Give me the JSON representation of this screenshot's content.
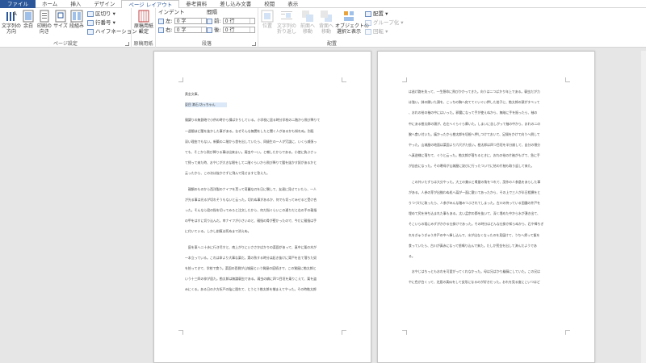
{
  "tabs": [
    {
      "label": "ファイル",
      "kind": "file"
    },
    {
      "label": "ホーム",
      "kind": ""
    },
    {
      "label": "挿入",
      "kind": ""
    },
    {
      "label": "デザイン",
      "kind": ""
    },
    {
      "label": "ページ レイアウト",
      "kind": "active"
    },
    {
      "label": "参考資料",
      "kind": ""
    },
    {
      "label": "差し込み文書",
      "kind": ""
    },
    {
      "label": "校閲",
      "kind": ""
    },
    {
      "label": "表示",
      "kind": ""
    }
  ],
  "ribbon": {
    "page_setup": {
      "label": "ページ設定",
      "text_direction": "文字列の\n方向",
      "margins": "余白",
      "orientation": "印刷の\n向き",
      "size": "サイズ",
      "columns": "段組み",
      "breaks": "区切り",
      "line_numbers": "行番号",
      "hyphenation": "ハイフネーション"
    },
    "manuscript": {
      "label": "原稿用紙",
      "button": "原稿用紙\n設定"
    },
    "paragraph": {
      "label": "段落",
      "indent_heading": "インデント",
      "spacing_heading": "間隔",
      "indent_left_label": "左:",
      "indent_right_label": "右:",
      "indent_left_value": "0 字",
      "indent_right_value": "0 字",
      "spacing_before_label": "前:",
      "spacing_after_label": "後:",
      "spacing_before_value": "0 行",
      "spacing_after_value": "0 行"
    },
    "arrange": {
      "label": "配置",
      "position": "位置",
      "wrap_text": "文字列の\n折り返し",
      "bring_forward": "前面へ\n移動",
      "send_backward": "背面へ\n移動",
      "selection_pane": "オブジェクトの\n選択と表示",
      "align": "配置",
      "group": "グループ化",
      "rotate": "回転"
    }
  },
  "page1": {
    "lines": [
      {
        "text": "黄金文庫。",
        "gap": 0
      },
      {
        "text": "夏目 漱石  坊っちゃん",
        "gap": 0,
        "name": true
      },
      {
        "text": "親譲りの無鉄砲で小供の時から損ばかりしている。小学校に居る時分学校の二階から飛び降りて",
        "gap": 1
      },
      {
        "text": "一週間ほど腰を抜かした事がある。なぜそんな無闇をしたと聞く人があるかも知れぬ。別段",
        "gap": 0
      },
      {
        "text": "深い理由でもない。新築の二階から首を出していたら、同級生の一人が冗談に、いくら威張っ",
        "gap": 0
      },
      {
        "text": "ても、そこから飛び降りる事は出来まい。弱虫やーい。と囃したからである。小使に負ぶさっ",
        "gap": 0
      },
      {
        "text": "て帰って来た時、おやじが大きな眼をして二階ぐらいから飛び降りて腰を抜かす奴があるかと",
        "gap": 0
      },
      {
        "text": "云ったから、この次は抜かさずに飛んで見せますと答えた。",
        "gap": 0
      },
      {
        "text": "　親類のものから西洋製のナイフを貰って奇麗な刃を日に翳して、友達に見せていたら、一人",
        "gap": 1
      },
      {
        "text": "が光る事は光るが切れそうもないと云った。切れぬ事があるか、何でも切ってみせると受け合",
        "gap": 0
      },
      {
        "text": "った。そんなら君の指を切ってみろと注文したから、何だ指ぐらいこの通りだと右の手の親指",
        "gap": 0
      },
      {
        "text": "の甲をはすに切り込んだ。幸ナイフが小さいのと、親指の骨が堅かったので、今だに親指は手",
        "gap": 0
      },
      {
        "text": "に付いている。しかし創痕は死ぬまで消えぬ。",
        "gap": 0
      },
      {
        "text": "　庭を東へ二十歩に行き尽すと、南上がりにいささかばかりの菜園があって、真中に栗の木が",
        "gap": 1
      },
      {
        "text": "一本立っている。これは命より大事な栗だ。実の熟する時分は起き抜けに背戸を出て落ちた奴",
        "gap": 0
      },
      {
        "text": "を拾ってきて、学校で食う。菜園の西側が山城屋という質屋の庭続きで、この質屋に勘太郎と",
        "gap": 0
      },
      {
        "text": "いう十三四の倅が居た。勘太郎は無論弱虫である。弱虫の癖に四つ目垣を乗りこえて、栗を盗",
        "gap": 0
      },
      {
        "text": "みにくる。ある日の夕方折戸の陰に隠れて、とうとう勘太郎を捕まえてやった。その時勘太郎",
        "gap": 0
      }
    ]
  },
  "page2": {
    "lines": [
      {
        "text": "は逃げ路を失って、一生懸命に飛びかかってきた。向うは二つばかり年上である。弱虫だが力",
        "gap": 0
      },
      {
        "text": "は強い。鉢の開いた頭を、こっちの胸へ宛ててぐいぐい押した拍子に、勘太郎の頭がすべって",
        "gap": 0
      },
      {
        "text": "、おれの袷の袖の中にはいった。邪魔になって手が使えぬから、無暗に手を振ったら、袖の",
        "gap": 0
      },
      {
        "text": "中にある勘太郎の頭が、右左へぐらぐら靡いた。しまいに苦しがって袖の中から、おれの二の",
        "gap": 0
      },
      {
        "text": "腕へ食い付いた。痛かったから勘太郎を垣根へ押しつけておいて、足搦をかけて向うへ倒して",
        "gap": 0
      },
      {
        "text": "やった。山城屋の地面は菜園より六尺がた低い。勘太郎は四つ目垣を半分崩して、自分の領分",
        "gap": 0
      },
      {
        "text": "へ真逆様に落ちて、ぐうと云った。勘太郎が落ちるときに、おれの袷の片袖がもげて、急に手",
        "gap": 0
      },
      {
        "text": "が自由になった。その晩母が山城屋に詫びに行ったついでに袷の片袖も取り返して来た。",
        "gap": 0
      },
      {
        "text": "　この外いたずらは大分やった。大工の兼公と肴屋の角をつれて、茂作の人参畠をあらした事",
        "gap": 1
      },
      {
        "text": "がある。人参の芽が出揃わぬ処へ藁が一面に敷いてあったから、その上で三人が半日相撲をと",
        "gap": 0
      },
      {
        "text": "りつづけに取ったら、人参がみんな踏みつぶされてしまった。古川の持っている田圃の井戸を",
        "gap": 0
      },
      {
        "text": "埋めて尻を持ち込まれた事もある。太い孟宗の節を抜いて、深く埋めた中から水が湧き出て、",
        "gap": 0
      },
      {
        "text": "そこいらの稲にみずがかかる仕掛けであった。その時分はどんな仕掛か知らぬから、石や棒ちぎ",
        "gap": 0
      },
      {
        "text": "れをぎゅうぎゅう井戸の中へ挿し込んで、水が出なくなったのを見届けて、うちへ帰って飯を",
        "gap": 0
      },
      {
        "text": "食っていたら、古川が真赤になって怒鳴り込んで来た。たしか罰金を出して済んだようであ",
        "gap": 0
      },
      {
        "text": "る。",
        "gap": 0
      },
      {
        "text": "　おやじはちっともおれを可愛がってくれなかった。母は兄ばかり贔屓にしていた。この兄は",
        "gap": 1
      },
      {
        "text": "やに色が白くって、芝居の真似をして女形になるのが好きだった。おれを見る度にこいつはど",
        "gap": 0
      }
    ]
  }
}
